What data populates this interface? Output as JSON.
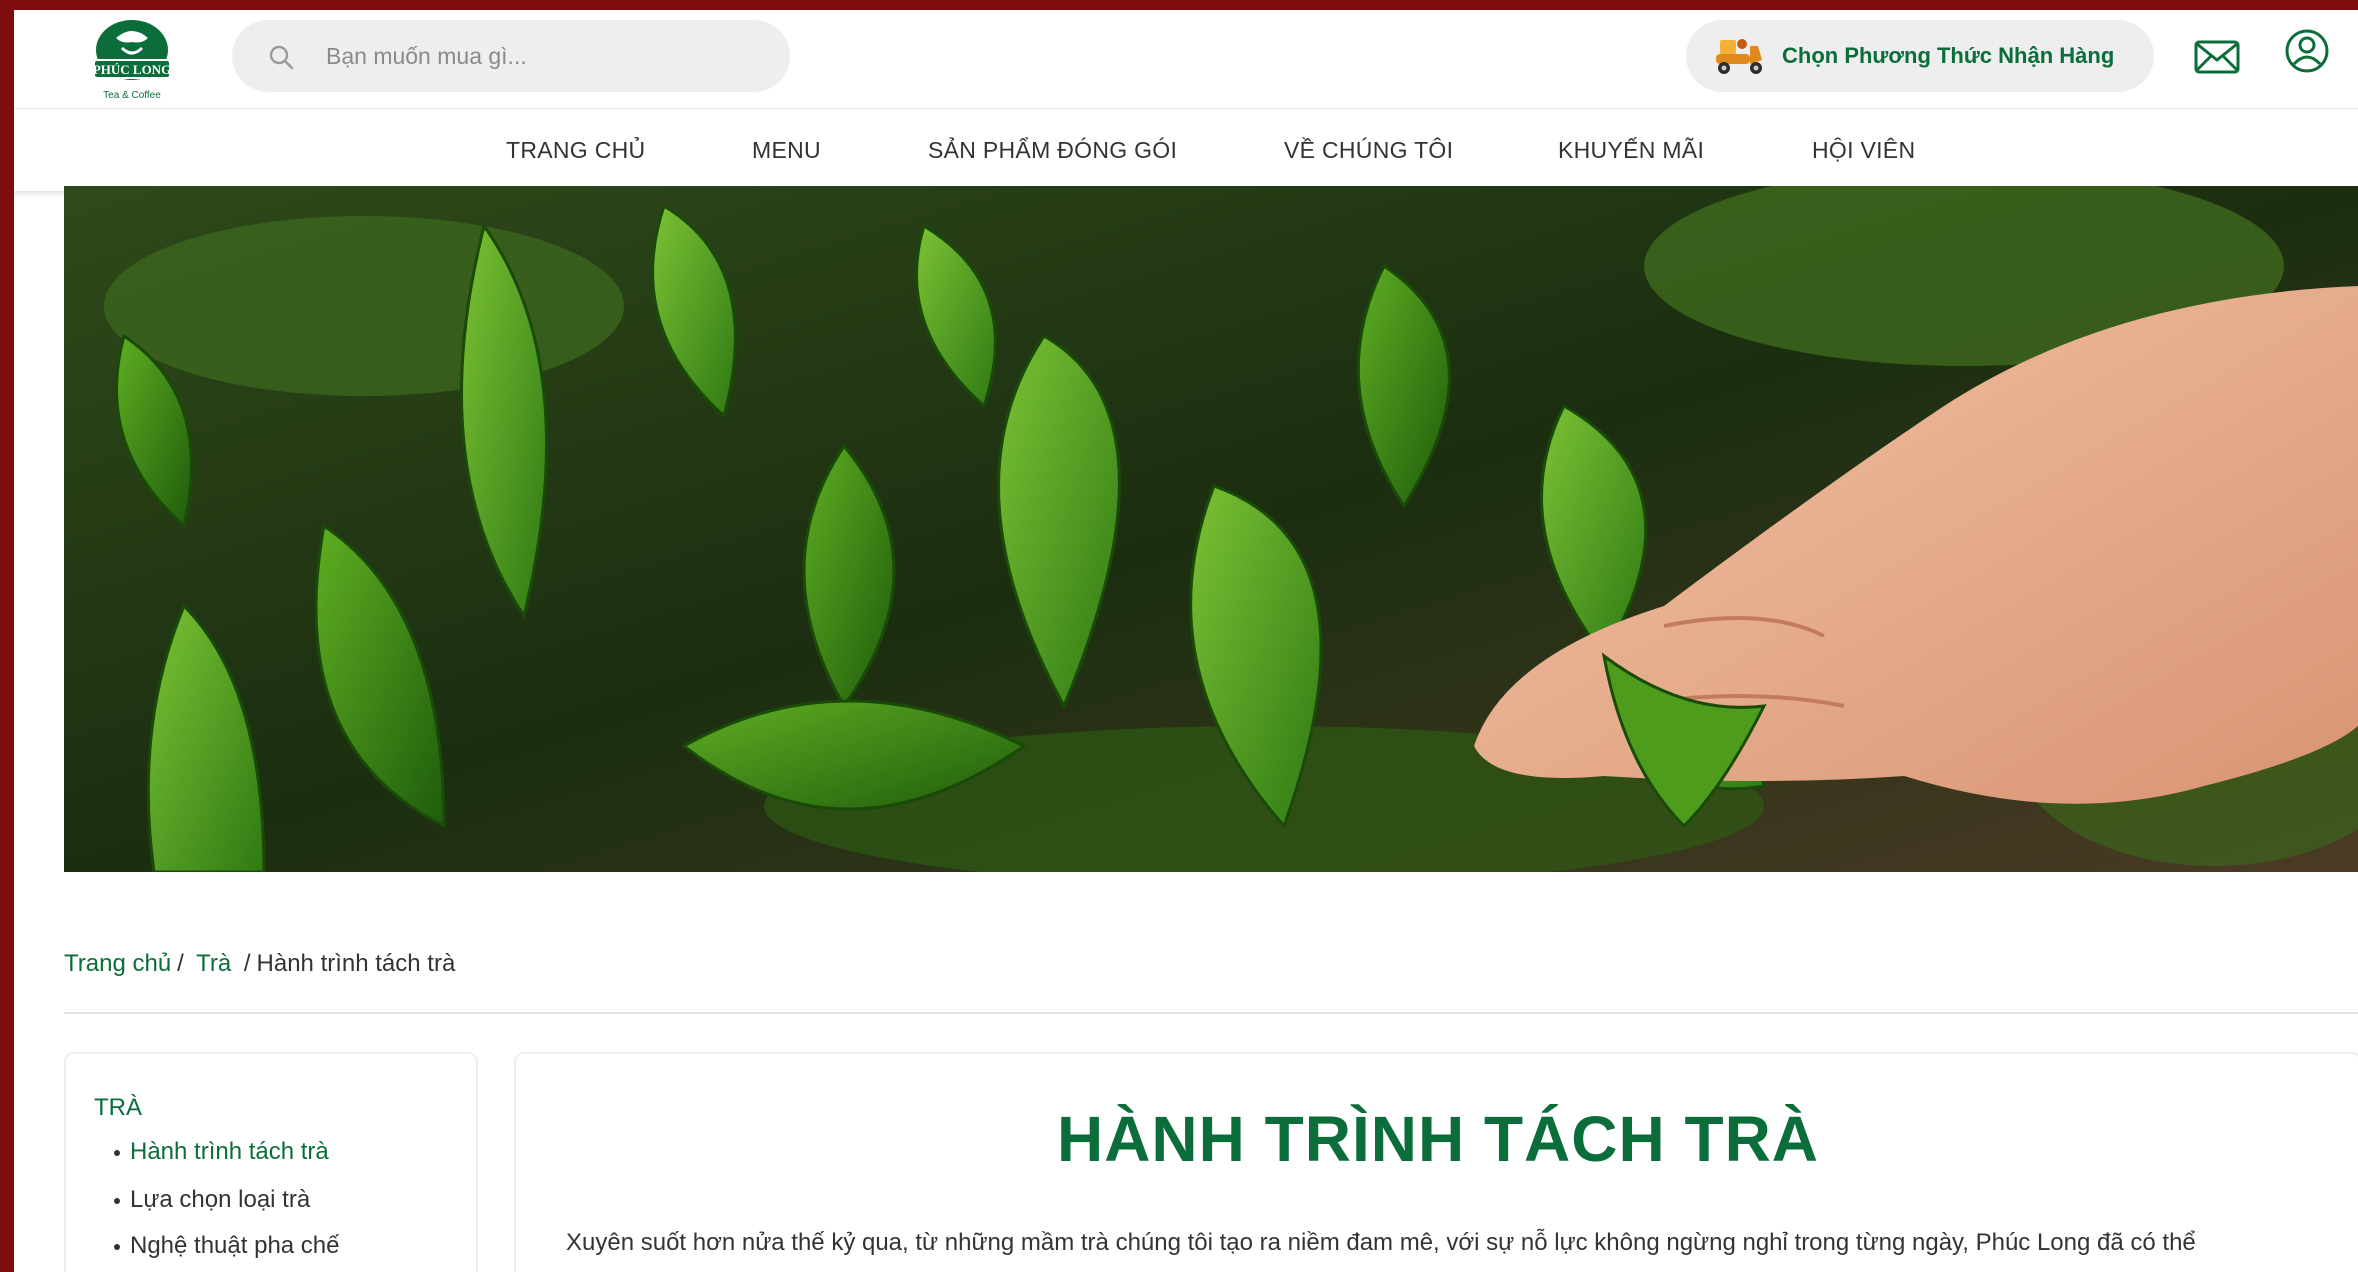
{
  "brand": {
    "logo_text": "PHÚC LONG",
    "logo_subtext": "Tea & Coffee",
    "primary_color": "#0b6e3a",
    "frame_color": "#7e0d0d"
  },
  "header": {
    "search_placeholder": "Bạn muốn mua gì...",
    "pickup_label": "Chọn Phương Thức Nhận Hàng",
    "icons": [
      "search-icon",
      "delivery-scooter-icon",
      "mail-icon",
      "user-icon"
    ]
  },
  "nav": {
    "items": [
      {
        "label": "TRANG CHỦ"
      },
      {
        "label": "MENU"
      },
      {
        "label": "SẢN PHẨM ĐÓNG GÓI"
      },
      {
        "label": "VỀ CHÚNG TÔI"
      },
      {
        "label": "KHUYẾN MÃI"
      },
      {
        "label": "HỘI VIÊN"
      }
    ]
  },
  "breadcrumb": {
    "home": "Trang chủ",
    "category": "Trà",
    "current": "Hành trình tách trà"
  },
  "sidebar": {
    "heading": "TRÀ",
    "items": [
      {
        "label": "Hành trình tách trà",
        "active": true
      },
      {
        "label": "Lựa chọn loại trà",
        "active": false
      },
      {
        "label": "Nghệ thuật pha chế",
        "active": false
      }
    ]
  },
  "article": {
    "title": "HÀNH TRÌNH TÁCH TRÀ",
    "paragraph": "Xuyên suốt hơn nửa thế kỷ qua, từ những mầm trà chúng tôi tạo ra niềm đam mê, với sự nỗ lực không ngừng nghỉ trong từng ngày, Phúc Long đã có thể"
  }
}
